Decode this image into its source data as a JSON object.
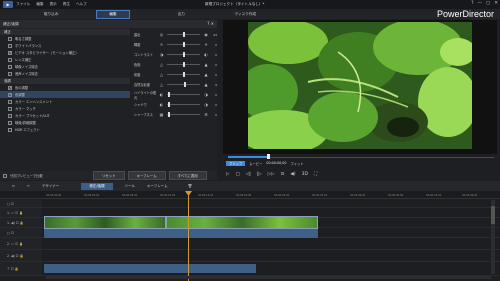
{
  "menu": {
    "items": [
      "ファイル",
      "編集",
      "表示",
      "再生",
      "ヘルプ"
    ],
    "title": "新規プロジェクト（タイトルなし）*",
    "win": [
      "?",
      "—",
      "▢",
      "✕"
    ]
  },
  "modes": [
    "取り込み",
    "編集",
    "出力",
    "ディスク作成"
  ],
  "brand": "PowerDirector",
  "panel": {
    "title": "補正/強調",
    "sec1": "補正",
    "sec1_items": [
      {
        "label": "明るさ調整",
        "checked": false
      },
      {
        "label": "ホワイトバランス",
        "checked": false
      },
      {
        "label": "ビデオ スタビライザー（モーション補正）",
        "checked": true
      },
      {
        "label": "レンズ補正",
        "checked": false
      },
      {
        "label": "映像ノイズ除去",
        "checked": false
      },
      {
        "label": "音声ノイズ除去",
        "checked": false
      }
    ],
    "sec2": "強調",
    "sec2_items": [
      {
        "label": "色の調整",
        "checked": true,
        "selected": false
      },
      {
        "label": "色調整",
        "checked": true,
        "selected": true
      },
      {
        "label": "カラー エンハンスメント",
        "checked": false,
        "selected": false
      },
      {
        "label": "カラー マッチ",
        "checked": false,
        "selected": false
      },
      {
        "label": "カラー プリセット/LUT",
        "checked": false,
        "selected": false
      },
      {
        "label": "映像/詳細調整",
        "checked": false,
        "selected": false
      },
      {
        "label": "HDR エフェクト",
        "checked": false,
        "selected": false
      }
    ],
    "sliders": [
      {
        "label": "露出",
        "value": 0.5,
        "num": "43"
      },
      {
        "label": "輝度",
        "value": 0.5,
        "num": "0"
      },
      {
        "label": "コントラスト",
        "value": 0.5,
        "num": "0"
      },
      {
        "label": "色相",
        "value": 0.5,
        "num": "0"
      },
      {
        "label": "彩度",
        "value": 0.5,
        "num": "0"
      },
      {
        "label": "自然な彩度",
        "value": 0.55,
        "num": "9"
      },
      {
        "label": "ハイライトの復元",
        "value": 0.02,
        "num": "0"
      },
      {
        "label": "シャドウ",
        "value": 0.02,
        "num": "0"
      },
      {
        "label": "シャープネス",
        "value": 0.02,
        "num": "0"
      }
    ],
    "footer_check": "分割プレビューで比較",
    "buttons": [
      "リセット",
      "キーフレーム",
      "すべてに適用"
    ]
  },
  "playback": {
    "times": [
      "00:00:00;00",
      "00;00",
      "00;00"
    ],
    "fit": "フィット",
    "labels": [
      "クリップ",
      "ムービー"
    ]
  },
  "toolbar": {
    "items": [
      "デザイナー",
      "修正/強調",
      "ツール",
      "キーフレーム"
    ]
  },
  "timeline": {
    "ticks": [
      "00;00;00;00",
      "00;00;03;10",
      "00;00;06;20",
      "00;00;10;00",
      "00;00;13;10",
      "00;00;16;20",
      "00;00;20;00",
      "00;00;23;10",
      "00;00;26;20",
      "00;00;30;00",
      "00;00;33;10",
      "00;00;36;20"
    ]
  },
  "colors": {
    "accent": "#3d8be0",
    "playhead": "#d29a2e",
    "selection": "#2f4560"
  }
}
